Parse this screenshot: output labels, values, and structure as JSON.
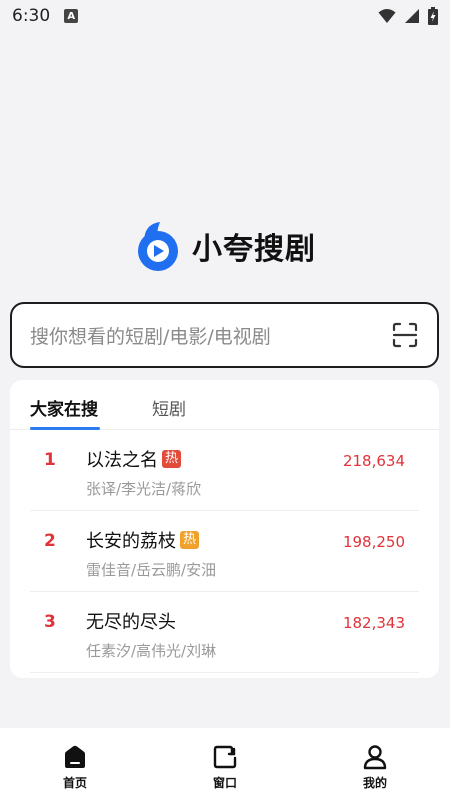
{
  "status_bar": {
    "time": "6:30",
    "badge": "A"
  },
  "brand": {
    "name": "小夸搜剧",
    "accent": "#1f6ff0"
  },
  "search": {
    "placeholder": "搜你想看的短剧/电影/电视剧"
  },
  "tabs": [
    {
      "label": "大家在搜",
      "active": true
    },
    {
      "label": "短剧",
      "active": false
    }
  ],
  "ranking": [
    {
      "rank": "1",
      "title": "以法之名",
      "badge": "热",
      "badge_color": "red",
      "cast": "张译/李光洁/蒋欣",
      "count": "218,634"
    },
    {
      "rank": "2",
      "title": "长安的荔枝",
      "badge": "热",
      "badge_color": "orange",
      "cast": "雷佳音/岳云鹏/安沺",
      "count": "198,250"
    },
    {
      "rank": "3",
      "title": "无尽的尽头",
      "badge": "",
      "badge_color": "",
      "cast": "任素汐/高伟光/刘琳",
      "count": "182,343"
    }
  ],
  "bottom_nav": [
    {
      "label": "首页",
      "icon": "home-icon"
    },
    {
      "label": "窗口",
      "icon": "window-icon"
    },
    {
      "label": "我的",
      "icon": "user-icon"
    }
  ]
}
